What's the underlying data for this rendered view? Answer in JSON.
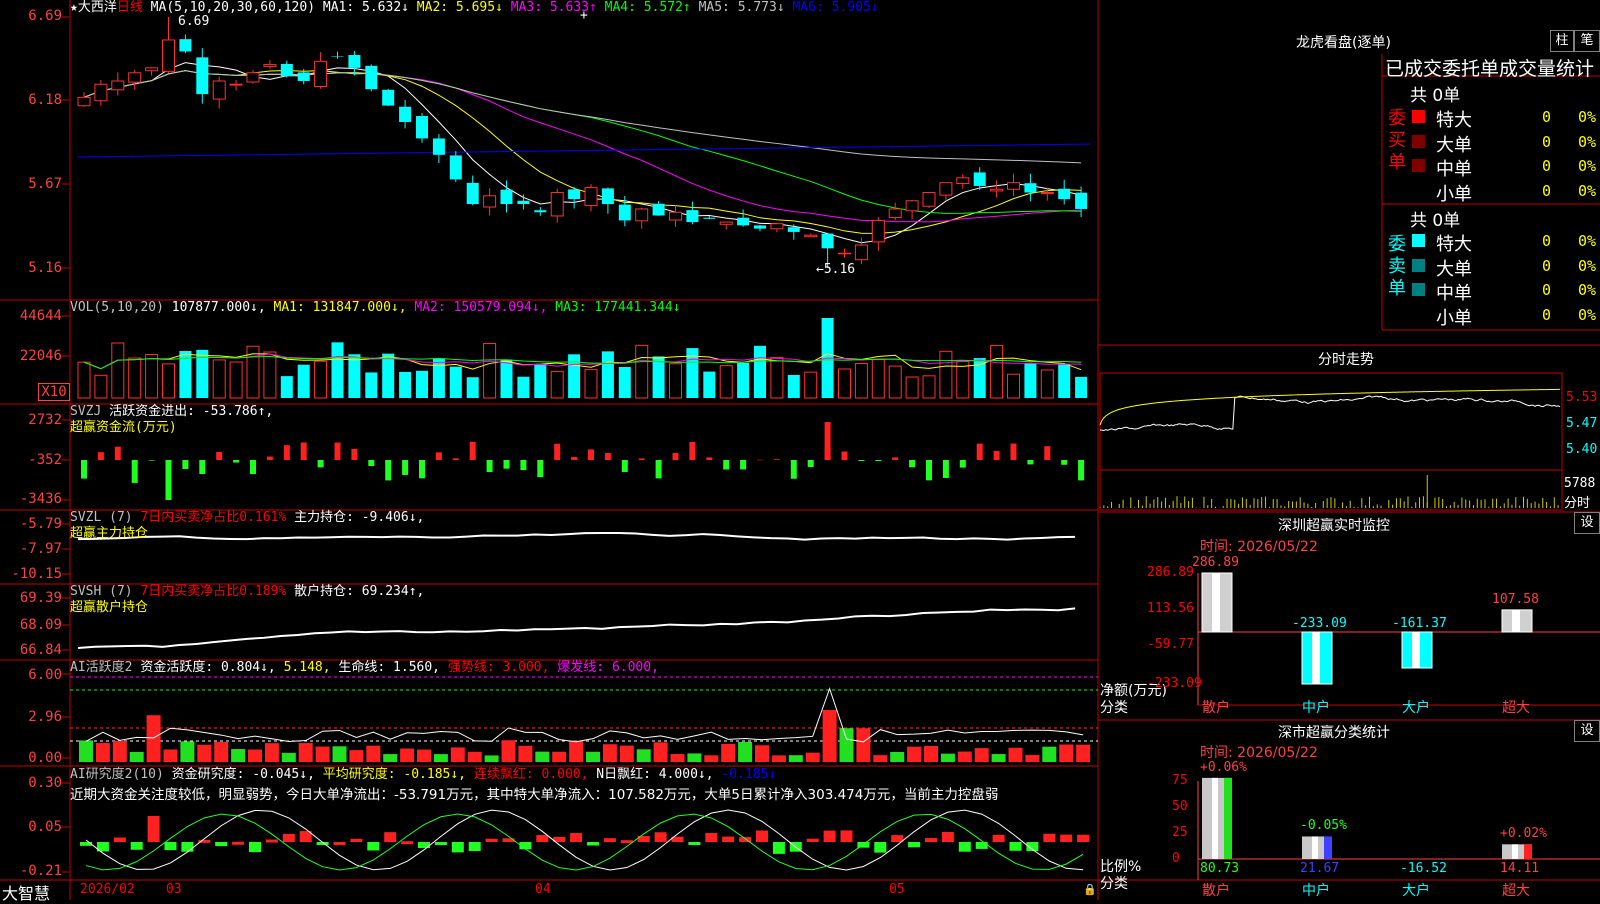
{
  "main": {
    "stock_name": "★大西洋",
    "period": "日线",
    "ma_params": "MA(5,10,20,30,60,120)",
    "ma1": "MA1: 5.632↓",
    "ma2": "MA2: 5.695↓",
    "ma3": "MA3: 5.633↑",
    "ma4": "MA4: 5.572↑",
    "ma5": "MA5: 5.773↓",
    "ma6": "MA6: 5.905↓",
    "high_label": "6.69",
    "low_label": "←5.16",
    "y_ticks": [
      "6.69",
      "6.18",
      "5.67",
      "5.16"
    ],
    "plus_mark": "+"
  },
  "vol": {
    "title": "VOL(5,10,20)",
    "value": "107877.000↓,",
    "ma1": "MA1: 131847.000↓,",
    "ma2": "MA2: 150579.094↓,",
    "ma3": "MA3: 177441.344↓",
    "y_ticks": [
      "44644",
      "22046"
    ],
    "unit": "X10"
  },
  "svzj": {
    "title": "SVZJ",
    "label": "活跃资金进出: -53.786↑,",
    "sub": "超赢资金流(万元)",
    "y_ticks": [
      "2732",
      "-352",
      "-3436"
    ]
  },
  "svzl": {
    "title": "SVZL (7)",
    "ratio": "7日内买卖净占比0.161%",
    "hold": "主力持仓: -9.406↓,",
    "sub": "超赢主力持仓",
    "y_ticks": [
      "-5.79",
      "-7.97",
      "-10.15"
    ]
  },
  "svsh": {
    "title": "SVSH (7)",
    "ratio": "7日内买卖净占比0.189%",
    "hold": "散户持仓: 69.234↑,",
    "sub": "超赢散户持仓",
    "y_ticks": [
      "69.39",
      "68.09",
      "66.84"
    ]
  },
  "ai1": {
    "title": "AI活跃度2",
    "val1": "资金活跃度: 0.804↓,",
    "val2": "5.148,",
    "val3": "生命线: 1.560,",
    "val4": "强势线: 3.000,",
    "val5": "爆发线: 6.000,",
    "y_ticks": [
      "6.00",
      "2.96",
      "0.00"
    ]
  },
  "ai2": {
    "title": "AI研究度2(10)",
    "val1": "资金研究度: -0.045↓,",
    "val2": "平均研究度: -0.185↓,",
    "val3": "连续飘红: 0.000,",
    "val4": "N日飘红: 4.000↓,",
    "val5": "-0.185↓",
    "comment": "近期大资金关注度较低，明显弱势，今日大单净流出：-53.791万元，其中特大单净流入：107.582万元，大单5日累计净入303.474万元，当前主力控盘弱",
    "y_ticks": [
      "0.30",
      "0.05",
      "-0.21"
    ]
  },
  "bottom": {
    "brand": "大智慧",
    "dates": [
      "2026/02",
      "03",
      "04",
      "05"
    ]
  },
  "lhb": {
    "title": "龙虎看盘(逐单)",
    "btn1": "柱",
    "btn2": "笔",
    "header": "已成交委托单成交量统计",
    "buy_side": "委买单",
    "sell_side": "委卖单",
    "buy_total": "共 0单",
    "sell_total": "共 0单",
    "buy_rows": [
      {
        "name": "特大",
        "count": "0",
        "pct": "0%",
        "color": "#ff0000"
      },
      {
        "name": "大单",
        "count": "0",
        "pct": "0%",
        "color": "#800000"
      },
      {
        "name": "中单",
        "count": "0",
        "pct": "0%",
        "color": "#800000"
      },
      {
        "name": "小单",
        "count": "0",
        "pct": "0%",
        "color": ""
      }
    ],
    "sell_rows": [
      {
        "name": "特大",
        "count": "0",
        "pct": "0%",
        "color": "#00ffff"
      },
      {
        "name": "大单",
        "count": "0",
        "pct": "0%",
        "color": "#008080"
      },
      {
        "name": "中单",
        "count": "0",
        "pct": "0%",
        "color": "#008080"
      },
      {
        "name": "小单",
        "count": "0",
        "pct": "0%",
        "color": ""
      }
    ]
  },
  "intraday": {
    "title": "分时走势",
    "y_ticks": [
      "5.53",
      "5.47",
      "5.40"
    ],
    "vol_label": "5788",
    "vol_unit": "分时"
  },
  "sz_monitor": {
    "title": "深圳超赢实时监控",
    "btn": "设",
    "time": "时间: 2026/05/22",
    "y_ticks": [
      "286.89",
      "113.56",
      "-59.77",
      "-233.09"
    ],
    "axis_label1": "净额(万元)",
    "axis_label2": "分类",
    "categories": [
      "散户",
      "中户",
      "大户",
      "超大"
    ],
    "values": [
      286.89,
      -233.09,
      -161.37,
      107.58
    ],
    "value_labels": [
      "286.89",
      "-233.09",
      "-161.37",
      "107.58"
    ]
  },
  "sz_class": {
    "title": "深市超赢分类统计",
    "btn": "设",
    "time": "时间: 2026/05/22",
    "y_ticks": [
      "75",
      "50",
      "25",
      "0"
    ],
    "axis_label1": "比例%",
    "axis_label2": "分类",
    "categories": [
      "散户",
      "中户",
      "大户",
      "超大"
    ],
    "bar_values": [
      80.73,
      21.67,
      -16.52,
      14.11
    ],
    "bar_labels": [
      "80.73",
      "21.67",
      "-16.52",
      "14.11"
    ],
    "change_labels": [
      "+0.06%",
      "-0.05%",
      "",
      "+0.02%"
    ]
  },
  "chart_data": [
    {
      "type": "candlestick",
      "title": "大西洋 日线",
      "x_dates": [
        "2026/02",
        "03",
        "04",
        "05"
      ],
      "ylim": [
        5.16,
        6.69
      ],
      "high": 6.69,
      "low": 5.16,
      "ma": {
        "MA1": 5.632,
        "MA2": 5.695,
        "MA3": 5.633,
        "MA4": 5.572,
        "MA5": 5.773,
        "MA6": 5.905
      }
    },
    {
      "type": "bar",
      "title": "VOL(5,10,20)",
      "current": 107877.0,
      "ma": {
        "MA1": 131847.0,
        "MA2": 150579.094,
        "MA3": 177441.344
      }
    },
    {
      "type": "bar",
      "title": "深圳超赢实时监控",
      "categories": [
        "散户",
        "中户",
        "大户",
        "超大"
      ],
      "values": [
        286.89,
        -233.09,
        -161.37,
        107.58
      ],
      "ylabel": "净额(万元)",
      "ylim": [
        -233.09,
        286.89
      ]
    },
    {
      "type": "bar",
      "title": "深市超赢分类统计",
      "categories": [
        "散户",
        "中户",
        "大户",
        "超大"
      ],
      "values": [
        80.73,
        21.67,
        -16.52,
        14.11
      ],
      "ylabel": "比例%",
      "ylim": [
        0,
        75
      ]
    }
  ]
}
